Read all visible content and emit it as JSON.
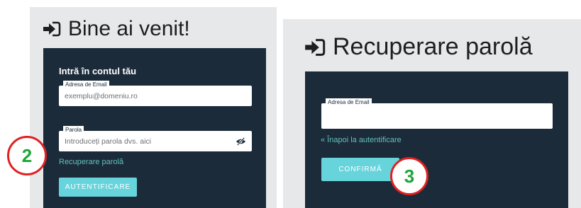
{
  "colors": {
    "panel_bg": "#e7e8ea",
    "card_bg": "#1c2b3a",
    "accent": "#67d4dc",
    "link": "#62c0ba",
    "badge_border": "#e02121",
    "badge_number": "#1ea63b"
  },
  "login": {
    "icon": "sign-in-icon",
    "heading": "Bine ai venit!",
    "card_title": "Intră în contul tău",
    "email_label": "Adresa de Email",
    "email_placeholder": "exemplu@domeniu.ro",
    "password_label": "Parola",
    "password_placeholder": "Introduceți parola dvs. aici",
    "password_toggle_icon": "eye-slash-icon",
    "recover_link": "Recuperare parolă",
    "submit_label": "AUTENTIFICARE",
    "step_number": "2"
  },
  "recovery": {
    "icon": "sign-in-icon",
    "heading": "Recuperare parolă",
    "email_label": "Adresa de Email",
    "email_value": "",
    "back_link": "« Înapoi la autentificare",
    "submit_label": "CONFIRMĂ",
    "step_number": "3"
  }
}
